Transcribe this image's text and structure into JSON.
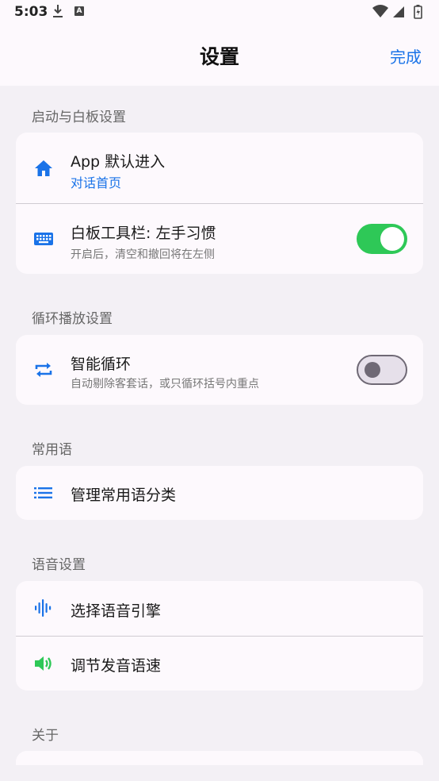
{
  "status_bar": {
    "time": "5:03",
    "a_badge": "A"
  },
  "app_bar": {
    "title": "设置",
    "done_label": "完成"
  },
  "sections": {
    "startup": {
      "title": "启动与白板设置",
      "default_entry": {
        "title": "App 默认进入",
        "value": "对话首页"
      },
      "whiteboard": {
        "title": "白板工具栏: 左手习惯",
        "subtitle": "开启后，清空和撤回将在左侧",
        "enabled": true
      }
    },
    "loop": {
      "title": "循环播放设置",
      "smart_loop": {
        "title": "智能循环",
        "subtitle": "自动剔除客套话，或只循环括号内重点",
        "enabled": false
      }
    },
    "phrases": {
      "title": "常用语",
      "manage": {
        "title": "管理常用语分类"
      }
    },
    "voice": {
      "title": "语音设置",
      "engine": {
        "title": "选择语音引擎"
      },
      "speed": {
        "title": "调节发音语速"
      }
    },
    "about": {
      "title": "关于"
    }
  },
  "colors": {
    "accent": "#1a73e8",
    "toggle_on": "#2ec857",
    "speaker": "#2ec857"
  },
  "icons": {
    "default_entry": "home-icon",
    "whiteboard": "keyboard-icon",
    "smart_loop": "repeat-icon",
    "manage": "list-icon",
    "engine": "waveform-icon",
    "speed": "speaker-icon"
  }
}
